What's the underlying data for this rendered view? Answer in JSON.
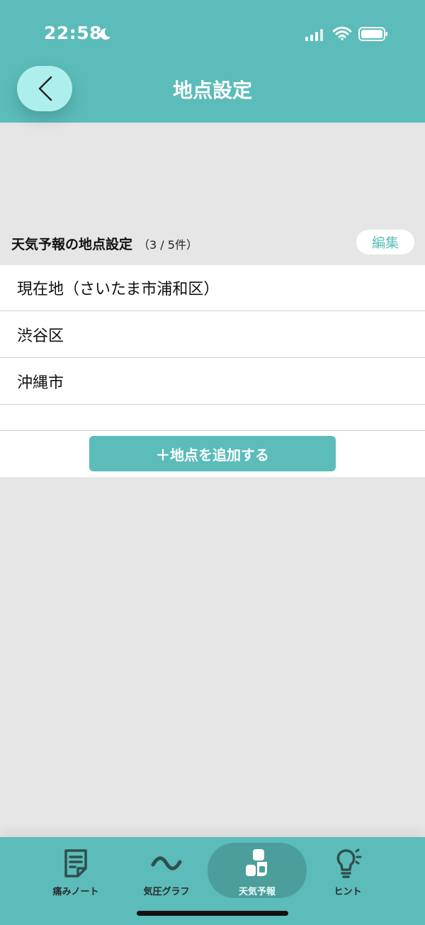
{
  "status_bar": {
    "time": "22:58"
  },
  "header": {
    "title": "地点設定"
  },
  "section": {
    "title": "天気予報の地点設定",
    "count": "（3 / 5件）",
    "edit_label": "編集"
  },
  "locations": [
    "現在地（さいたま市浦和区）",
    "渋谷区",
    "沖縄市"
  ],
  "add_button_label": "＋地点を追加する",
  "tabs": [
    {
      "label": "痛みノート",
      "icon": "note-icon",
      "active": false
    },
    {
      "label": "気圧グラフ",
      "icon": "wave-icon",
      "active": false
    },
    {
      "label": "天気予報",
      "icon": "weather-icon",
      "active": true
    },
    {
      "label": "ヒント",
      "icon": "lightbulb-icon",
      "active": false
    }
  ],
  "colors": {
    "accent": "#5bbcba",
    "accent_dark": "#4c9e9c",
    "back_button": "#aeefed",
    "background": "#e6e6e6"
  }
}
